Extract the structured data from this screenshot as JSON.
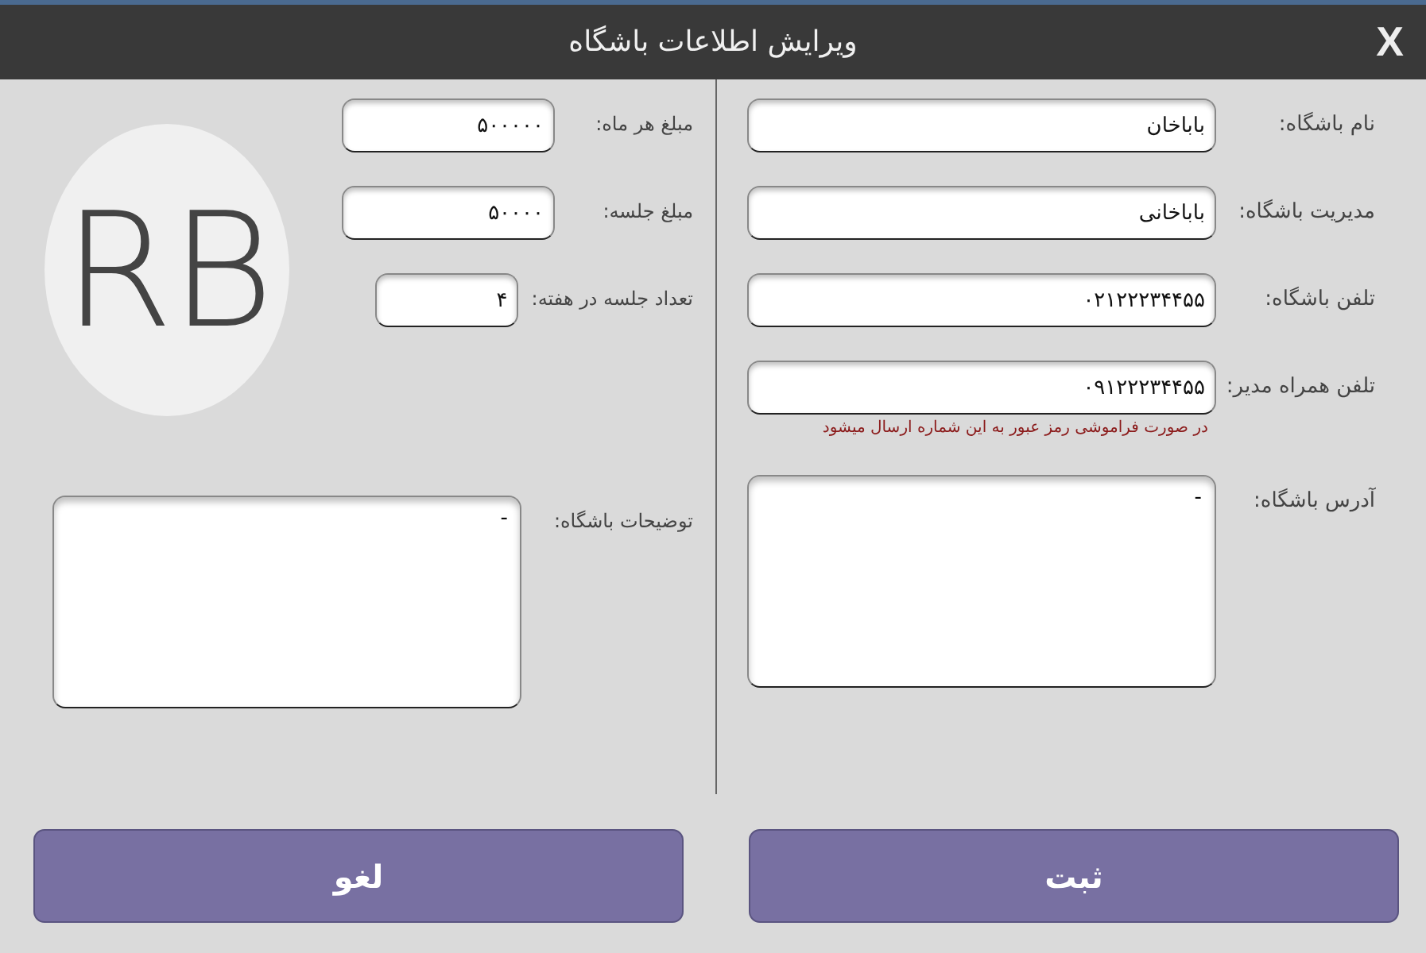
{
  "window": {
    "title": "ویرایش اطلاعات باشگاه",
    "close": "X"
  },
  "right_fields": [
    {
      "label": "نام باشگاه:",
      "value": "باباخان"
    },
    {
      "label": "مدیریت باشگاه:",
      "value": "باباخانی"
    },
    {
      "label": "تلفن باشگاه:",
      "value": "۰۲۱۲۲۲۳۴۴۵۵"
    },
    {
      "label": "تلفن همراه مدیر:",
      "value": "۰۹۱۲۲۲۳۴۴۵۵",
      "hint": "در صورت فراموشی رمز عبور به این شماره ارسال میشود"
    }
  ],
  "address": {
    "label": "آدرس باشگاه:",
    "value": "-"
  },
  "left_fields": [
    {
      "label": "مبلغ هر ماه:",
      "value": "۵۰۰۰۰۰",
      "kind": "wide"
    },
    {
      "label": "مبلغ جلسه:",
      "value": "۵۰۰۰۰",
      "kind": "wide"
    },
    {
      "label": "تعداد جلسه در هفته:",
      "value": "۴",
      "kind": "narrow"
    }
  ],
  "avatar": {
    "initials": "RB"
  },
  "description": {
    "label": "توضیحات باشگاه:",
    "value": "-"
  },
  "buttons": [
    {
      "label": "ثبت"
    },
    {
      "label": "لغو"
    }
  ]
}
